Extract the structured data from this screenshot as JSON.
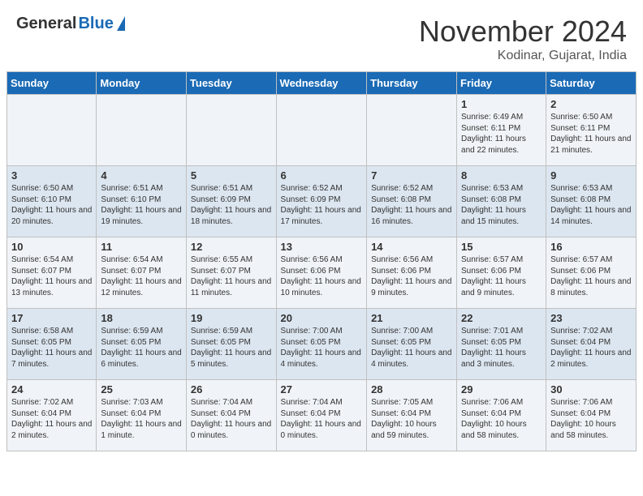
{
  "header": {
    "logo_general": "General",
    "logo_blue": "Blue",
    "month_title": "November 2024",
    "location": "Kodinar, Gujarat, India"
  },
  "weekdays": [
    "Sunday",
    "Monday",
    "Tuesday",
    "Wednesday",
    "Thursday",
    "Friday",
    "Saturday"
  ],
  "weeks": [
    [
      {
        "day": "",
        "info": ""
      },
      {
        "day": "",
        "info": ""
      },
      {
        "day": "",
        "info": ""
      },
      {
        "day": "",
        "info": ""
      },
      {
        "day": "",
        "info": ""
      },
      {
        "day": "1",
        "info": "Sunrise: 6:49 AM\nSunset: 6:11 PM\nDaylight: 11 hours and 22 minutes."
      },
      {
        "day": "2",
        "info": "Sunrise: 6:50 AM\nSunset: 6:11 PM\nDaylight: 11 hours and 21 minutes."
      }
    ],
    [
      {
        "day": "3",
        "info": "Sunrise: 6:50 AM\nSunset: 6:10 PM\nDaylight: 11 hours and 20 minutes."
      },
      {
        "day": "4",
        "info": "Sunrise: 6:51 AM\nSunset: 6:10 PM\nDaylight: 11 hours and 19 minutes."
      },
      {
        "day": "5",
        "info": "Sunrise: 6:51 AM\nSunset: 6:09 PM\nDaylight: 11 hours and 18 minutes."
      },
      {
        "day": "6",
        "info": "Sunrise: 6:52 AM\nSunset: 6:09 PM\nDaylight: 11 hours and 17 minutes."
      },
      {
        "day": "7",
        "info": "Sunrise: 6:52 AM\nSunset: 6:08 PM\nDaylight: 11 hours and 16 minutes."
      },
      {
        "day": "8",
        "info": "Sunrise: 6:53 AM\nSunset: 6:08 PM\nDaylight: 11 hours and 15 minutes."
      },
      {
        "day": "9",
        "info": "Sunrise: 6:53 AM\nSunset: 6:08 PM\nDaylight: 11 hours and 14 minutes."
      }
    ],
    [
      {
        "day": "10",
        "info": "Sunrise: 6:54 AM\nSunset: 6:07 PM\nDaylight: 11 hours and 13 minutes."
      },
      {
        "day": "11",
        "info": "Sunrise: 6:54 AM\nSunset: 6:07 PM\nDaylight: 11 hours and 12 minutes."
      },
      {
        "day": "12",
        "info": "Sunrise: 6:55 AM\nSunset: 6:07 PM\nDaylight: 11 hours and 11 minutes."
      },
      {
        "day": "13",
        "info": "Sunrise: 6:56 AM\nSunset: 6:06 PM\nDaylight: 11 hours and 10 minutes."
      },
      {
        "day": "14",
        "info": "Sunrise: 6:56 AM\nSunset: 6:06 PM\nDaylight: 11 hours and 9 minutes."
      },
      {
        "day": "15",
        "info": "Sunrise: 6:57 AM\nSunset: 6:06 PM\nDaylight: 11 hours and 9 minutes."
      },
      {
        "day": "16",
        "info": "Sunrise: 6:57 AM\nSunset: 6:06 PM\nDaylight: 11 hours and 8 minutes."
      }
    ],
    [
      {
        "day": "17",
        "info": "Sunrise: 6:58 AM\nSunset: 6:05 PM\nDaylight: 11 hours and 7 minutes."
      },
      {
        "day": "18",
        "info": "Sunrise: 6:59 AM\nSunset: 6:05 PM\nDaylight: 11 hours and 6 minutes."
      },
      {
        "day": "19",
        "info": "Sunrise: 6:59 AM\nSunset: 6:05 PM\nDaylight: 11 hours and 5 minutes."
      },
      {
        "day": "20",
        "info": "Sunrise: 7:00 AM\nSunset: 6:05 PM\nDaylight: 11 hours and 4 minutes."
      },
      {
        "day": "21",
        "info": "Sunrise: 7:00 AM\nSunset: 6:05 PM\nDaylight: 11 hours and 4 minutes."
      },
      {
        "day": "22",
        "info": "Sunrise: 7:01 AM\nSunset: 6:05 PM\nDaylight: 11 hours and 3 minutes."
      },
      {
        "day": "23",
        "info": "Sunrise: 7:02 AM\nSunset: 6:04 PM\nDaylight: 11 hours and 2 minutes."
      }
    ],
    [
      {
        "day": "24",
        "info": "Sunrise: 7:02 AM\nSunset: 6:04 PM\nDaylight: 11 hours and 2 minutes."
      },
      {
        "day": "25",
        "info": "Sunrise: 7:03 AM\nSunset: 6:04 PM\nDaylight: 11 hours and 1 minute."
      },
      {
        "day": "26",
        "info": "Sunrise: 7:04 AM\nSunset: 6:04 PM\nDaylight: 11 hours and 0 minutes."
      },
      {
        "day": "27",
        "info": "Sunrise: 7:04 AM\nSunset: 6:04 PM\nDaylight: 11 hours and 0 minutes."
      },
      {
        "day": "28",
        "info": "Sunrise: 7:05 AM\nSunset: 6:04 PM\nDaylight: 10 hours and 59 minutes."
      },
      {
        "day": "29",
        "info": "Sunrise: 7:06 AM\nSunset: 6:04 PM\nDaylight: 10 hours and 58 minutes."
      },
      {
        "day": "30",
        "info": "Sunrise: 7:06 AM\nSunset: 6:04 PM\nDaylight: 10 hours and 58 minutes."
      }
    ]
  ]
}
